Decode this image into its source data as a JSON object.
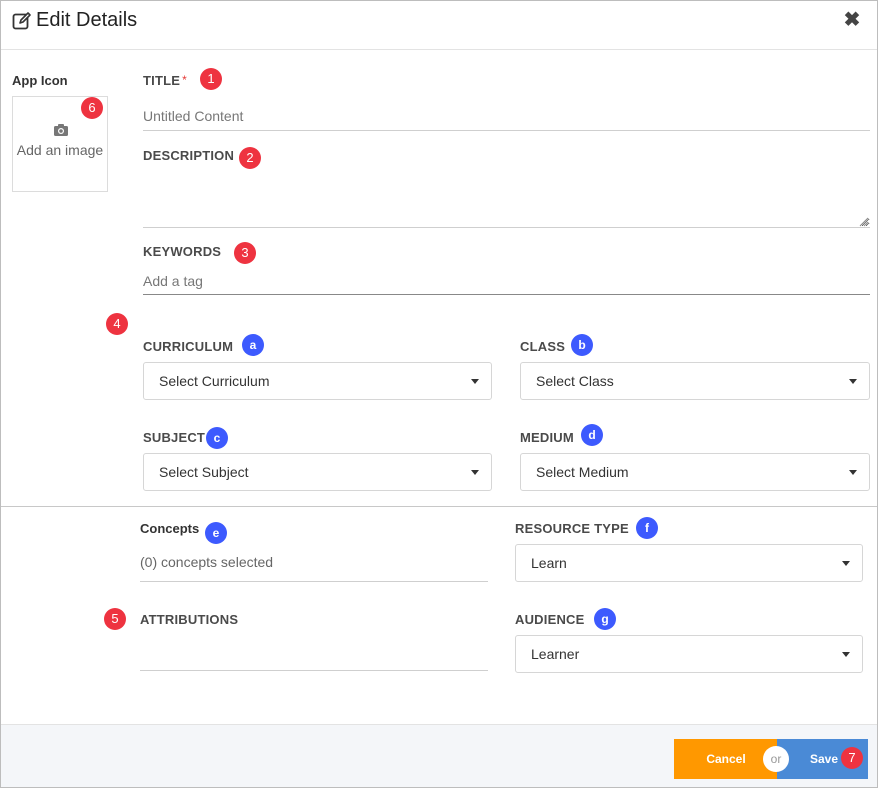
{
  "header": {
    "title": "Edit Details",
    "edit_icon": "edit-icon",
    "close_icon": "close-icon"
  },
  "app_icon": {
    "label": "App Icon",
    "add_image_text": "Add an image",
    "icon": "camera-icon"
  },
  "fields": {
    "title": {
      "label": "TITLE",
      "required_mark": "*",
      "value": "",
      "placeholder": "Untitled Content"
    },
    "description": {
      "label": "DESCRIPTION",
      "value": ""
    },
    "keywords": {
      "label": "KEYWORDS",
      "placeholder": "Add a tag"
    }
  },
  "selects": {
    "curriculum": {
      "label": "CURRICULUM",
      "value": "Select Curriculum"
    },
    "class": {
      "label": "CLASS",
      "value": "Select Class"
    },
    "subject": {
      "label": "SUBJECT",
      "value": "Select Subject"
    },
    "medium": {
      "label": "MEDIUM",
      "value": "Select Medium"
    },
    "resource_type": {
      "label": "RESOURCE TYPE",
      "value": "Learn"
    },
    "audience": {
      "label": "AUDIENCE",
      "value": "Learner"
    }
  },
  "concepts": {
    "label": "Concepts",
    "value": "(0) concepts selected"
  },
  "attributions": {
    "label": "ATTRIBUTIONS"
  },
  "badges": {
    "n1": "1",
    "n2": "2",
    "n3": "3",
    "n4": "4",
    "n5": "5",
    "n6": "6",
    "n7": "7",
    "a": "a",
    "b": "b",
    "c": "c",
    "d": "d",
    "e": "e",
    "f": "f",
    "g": "g"
  },
  "footer": {
    "cancel_label": "Cancel",
    "or_label": "or",
    "save_label": "Save"
  },
  "colors": {
    "cancel": "#ff9800",
    "save": "#4a8ad6",
    "badge_red": "#ee3340",
    "badge_blue": "#3d5afe"
  }
}
